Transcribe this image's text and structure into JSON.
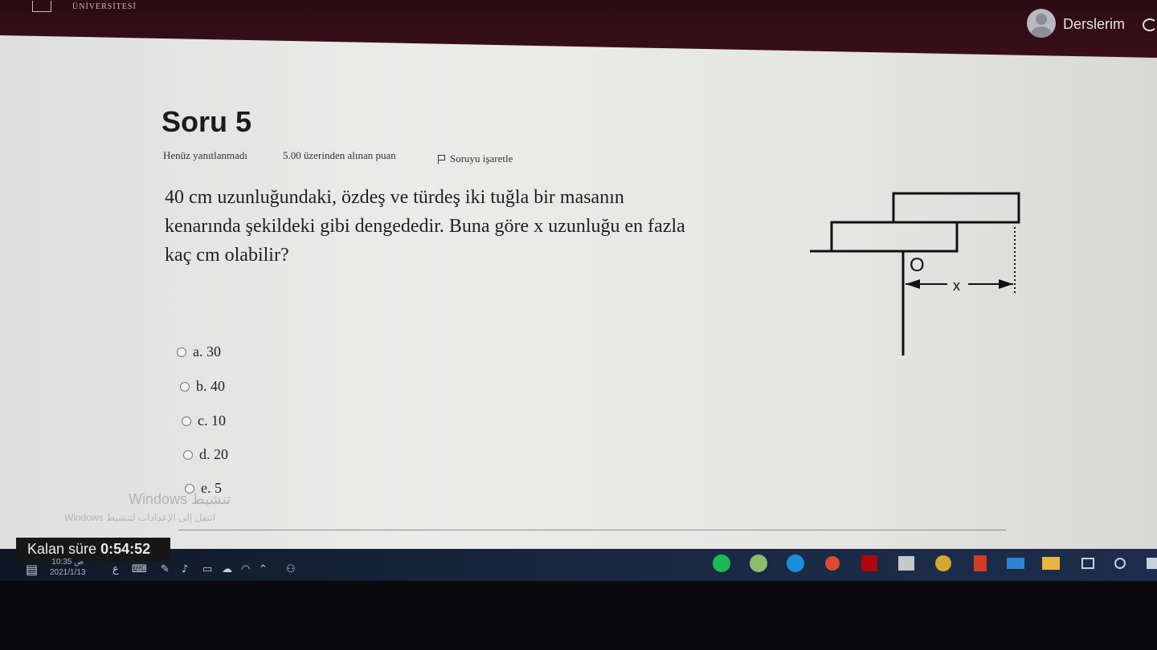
{
  "header": {
    "logo_text": "ÜNİVERSİTESİ",
    "courses_label": "Derslerim"
  },
  "question": {
    "title": "Soru 5",
    "state": "Henüz yanıtlanmadı",
    "grade": "5.00 üzerinden alınan puan",
    "flag_label": "Soruyu işaretle",
    "text_lines": [
      "40 cm uzunluğundaki, özdeş ve türdeş iki tuğla bir masanın",
      "kenarında şekildeki gibi dengededir. Buna göre x uzunluğu en fazla",
      "kaç cm olabilir?"
    ],
    "figure": {
      "point_label": "O",
      "length_label": "x"
    },
    "answers": [
      {
        "label": "a. 30"
      },
      {
        "label": "b. 40"
      },
      {
        "label": "c. 10"
      },
      {
        "label": "d. 20"
      },
      {
        "label": "e. 5"
      }
    ]
  },
  "watermark": {
    "line1": "Windows تنشيط",
    "line2": "Windows انتقل إلى الإعدادات لتنشيط"
  },
  "timer": {
    "label": "Kalan süre",
    "value": "0:54:52"
  },
  "taskbar": {
    "time": "10:35 ص",
    "date": "2021/1/13",
    "lang": "ع"
  }
}
